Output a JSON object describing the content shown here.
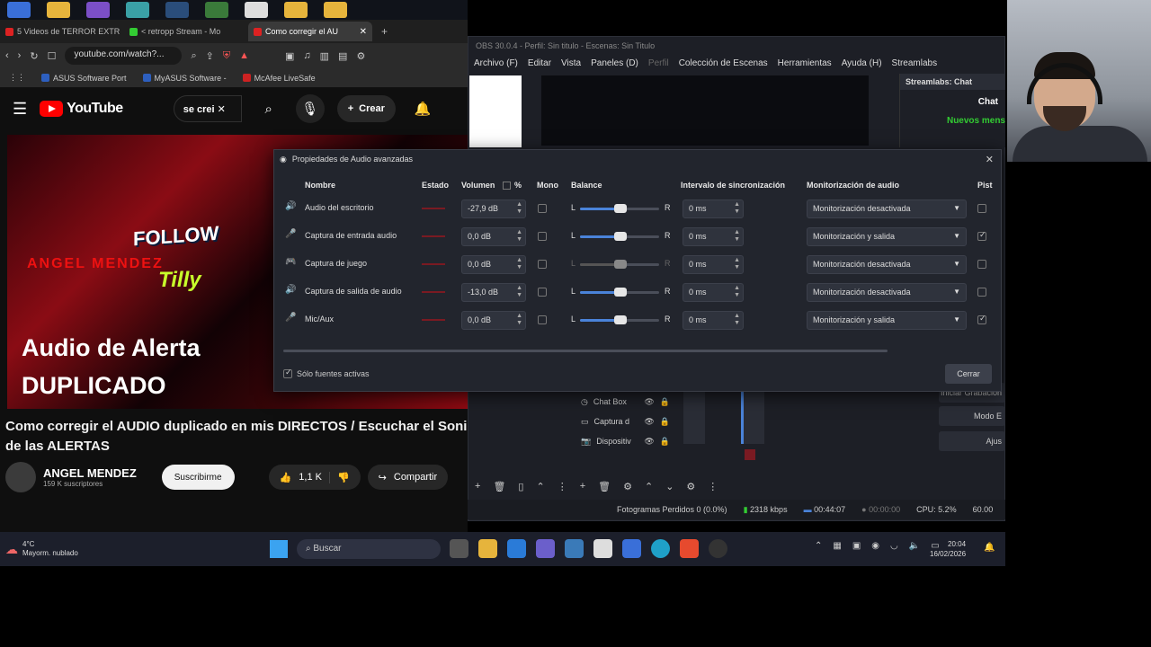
{
  "browser": {
    "tabs": [
      {
        "label": "5 Videos de TERROR EXTR",
        "color": "#d22"
      },
      {
        "label": "< retropp Stream - Mo",
        "color": "#3c3"
      },
      {
        "label": "Como corregir el AU",
        "color": "#d22"
      }
    ],
    "url": "youtube.com/watch?...",
    "bookmarks": [
      "ASUS Software Port",
      "MyASUS Software -",
      "McAfee LiveSafe"
    ]
  },
  "youtube": {
    "logo": "YouTube",
    "search_value": "se crei",
    "create_label": "Crear",
    "thumb": {
      "follow": "FOLLOW",
      "angel": "ANGEL MENDEZ",
      "tilly": "Tilly",
      "line1": "Audio de Alerta",
      "line2": "DUPLICADO"
    },
    "title": "Como corregir el AUDIO duplicado en mis DIRECTOS / Escuchar el Soni de las ALERTAS",
    "channel": "ANGEL MENDEZ",
    "subscribers": "159 K suscriptores",
    "subscribe_label": "Suscribirme",
    "likes": "1,1 K",
    "share_label": "Compartir"
  },
  "obs": {
    "title": "OBS 30.0.4 - Perfil: Sin titulo - Escenas: Sin Titulo",
    "menu": [
      "Archivo (F)",
      "Editar",
      "Vista",
      "Paneles (D)",
      "Perfil",
      "Colección de Escenas",
      "Herramientas",
      "Ayuda (H)",
      "Streamlabs"
    ],
    "chat_dock_title": "Streamlabs: Chat",
    "chat_label": "Chat",
    "new_label": "Nuevos mens",
    "sources": [
      "Chat Box",
      "Captura d",
      "Dispositiv"
    ],
    "controls": [
      "Iniciar Grabación",
      "Modo E",
      "Ajus"
    ],
    "status": {
      "dropped": "Fotogramas Perdidos 0 (0.0%)",
      "kbps": "2318 kbps",
      "stream_time": "00:44:07",
      "rec_time": "00:00:00",
      "cpu": "CPU: 5.2%",
      "fps": "60.00"
    }
  },
  "dialog": {
    "title": "Propiedades de Audio avanzadas",
    "headers": {
      "name": "Nombre",
      "state": "Estado",
      "volume": "Volumen",
      "percent": "%",
      "mono": "Mono",
      "balance": "Balance",
      "sync": "Intervalo de sincronización",
      "monitor": "Monitorización de audio",
      "tracks": "Pist"
    },
    "rows": [
      {
        "icon": "🔊",
        "name": "Audio del escritorio",
        "volume": "-27,9 dB",
        "sync": "0 ms",
        "monitor": "Monitorización desactivada",
        "track": false,
        "balance_enabled": true
      },
      {
        "icon": "🎤",
        "name": "Captura de entrada audio",
        "volume": "0,0 dB",
        "sync": "0 ms",
        "monitor": "Monitorización y salida",
        "track": true,
        "balance_enabled": true
      },
      {
        "icon": "🎮",
        "name": "Captura de juego",
        "volume": "0,0 dB",
        "sync": "0 ms",
        "monitor": "Monitorización desactivada",
        "track": false,
        "balance_enabled": false
      },
      {
        "icon": "🔊",
        "name": "Captura de salida de audio",
        "volume": "-13,0 dB",
        "sync": "0 ms",
        "monitor": "Monitorización desactivada",
        "track": false,
        "balance_enabled": true
      },
      {
        "icon": "🎤",
        "name": "Mic/Aux",
        "volume": "0,0 dB",
        "sync": "0 ms",
        "monitor": "Monitorización y salida",
        "track": true,
        "balance_enabled": true
      }
    ],
    "balance_L": "L",
    "balance_R": "R",
    "active_only_label": "Sólo fuentes activas",
    "close_label": "Cerrar"
  },
  "taskbar": {
    "temp": "4°C",
    "weather": "Mayorm. nublado",
    "search": "Buscar",
    "time": "20:04",
    "date": "16/02/2026"
  },
  "colors": {
    "accent": "#4a83d9",
    "youtube_red": "#ff0000"
  }
}
